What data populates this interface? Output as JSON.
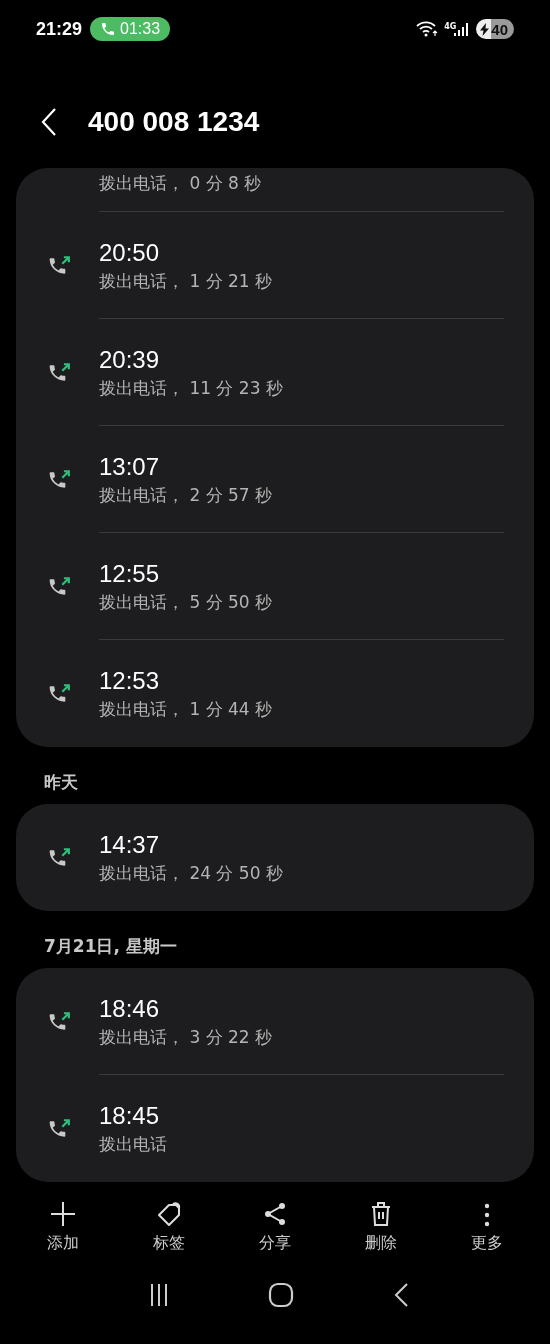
{
  "status_bar": {
    "time": "21:29",
    "call_timer": "01:33",
    "network": "4G",
    "battery": "40"
  },
  "header": {
    "title": "400 008 1234"
  },
  "groups": [
    {
      "calls": [
        {
          "detail": "拨出电话， 0 分 8 秒",
          "partial": true
        },
        {
          "time": "20:50",
          "detail": "拨出电话， 1 分 21 秒"
        },
        {
          "time": "20:39",
          "detail": "拨出电话， 11 分 23 秒"
        },
        {
          "time": "13:07",
          "detail": "拨出电话， 2 分 57 秒"
        },
        {
          "time": "12:55",
          "detail": "拨出电话， 5 分 50 秒"
        },
        {
          "time": "12:53",
          "detail": "拨出电话， 1 分 44 秒"
        }
      ]
    },
    {
      "label": "昨天",
      "calls": [
        {
          "time": "14:37",
          "detail": "拨出电话， 24 分 50 秒"
        }
      ]
    },
    {
      "label": "7月21日, 星期一",
      "calls": [
        {
          "time": "18:46",
          "detail": "拨出电话， 3 分 22 秒"
        },
        {
          "time": "18:45",
          "detail": "拨出电话"
        }
      ]
    }
  ],
  "toolbar": [
    {
      "kind": "add",
      "label": "添加"
    },
    {
      "kind": "tag",
      "label": "标签"
    },
    {
      "kind": "share",
      "label": "分享"
    },
    {
      "kind": "delete",
      "label": "删除"
    },
    {
      "kind": "more",
      "label": "更多"
    }
  ]
}
